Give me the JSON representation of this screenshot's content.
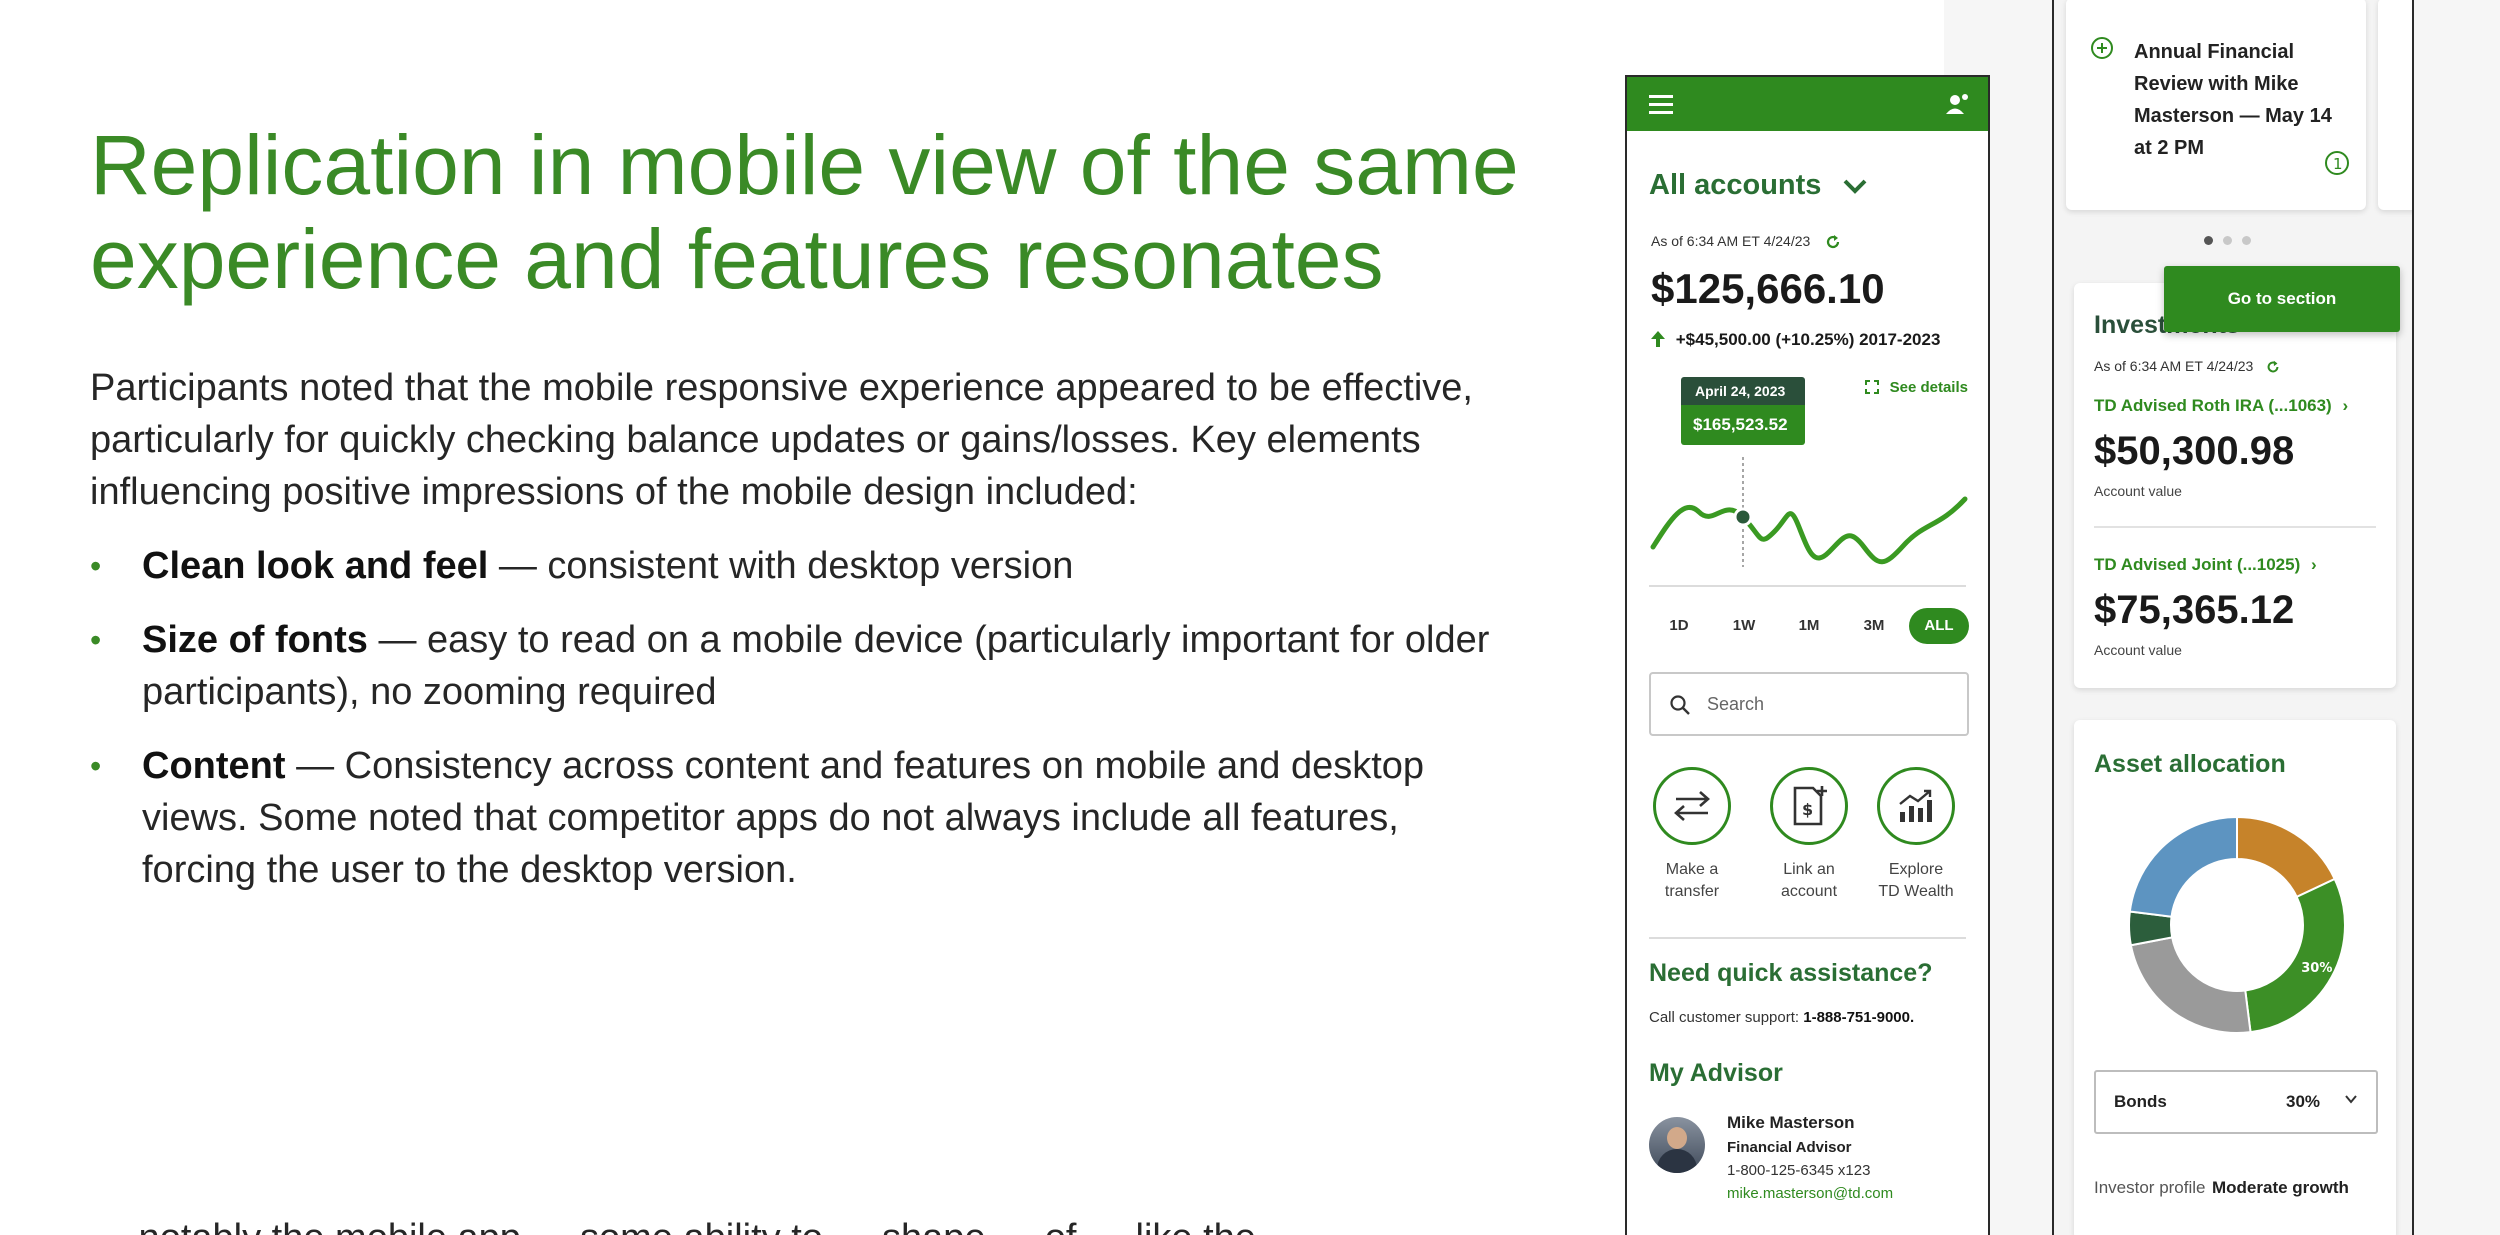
{
  "slide": {
    "title": "Replication in mobile view of the same experience and features resonates",
    "intro": "Participants noted that the mobile responsive experience appeared to be effective, particularly for quickly checking balance updates or gains/losses. Key elements influencing positive impressions of the mobile design included:",
    "bullets": [
      {
        "bold": "Clean look and feel",
        "text": " — consistent with desktop version"
      },
      {
        "bold": "Size of fonts",
        "text": " — easy to read on a mobile device (particularly important for older participants), no zooming required"
      },
      {
        "bold": "Content",
        "text": " — Consistency across content and features on mobile and desktop views. Some noted that competitor apps do not always include all features, forcing the user to the desktop version."
      }
    ],
    "cut_off_line": "… notably the mobile app … some ability to … shape … of … like the …"
  },
  "phone_main": {
    "header": {
      "menu_icon": "hamburger-icon",
      "user_icon": "user-settings-icon",
      "color": "#2f8a1f"
    },
    "accounts_heading": "All accounts",
    "as_of": "As of 6:34 AM ET 4/24/23",
    "balance": "$125,666.10",
    "gain": "+$45,500.00 (+10.25%) 2017-2023",
    "see_details": "See details",
    "tooltip": {
      "date": "April 24, 2023",
      "value": "$165,523.52"
    },
    "ranges": [
      "1D",
      "1W",
      "1M",
      "3M",
      "ALL"
    ],
    "active_range": "ALL",
    "search_placeholder": "Search",
    "actions": [
      {
        "l1": "Make a",
        "l2": "transfer",
        "icon": "transfer-icon"
      },
      {
        "l1": "Link an",
        "l2": "account",
        "icon": "link-account-icon"
      },
      {
        "l1": "Explore",
        "l2": "TD Wealth",
        "icon": "growth-chart-icon"
      }
    ],
    "assist_heading": "Need quick assistance?",
    "call_label": "Call customer support: ",
    "call_number": "1-888-751-9000.",
    "advisor_heading": "My Advisor",
    "advisor": {
      "name": "Mike Masterson",
      "title": "Financial Advisor",
      "phone": "1-800-125-6345 x123",
      "email": "mike.masterson@td.com"
    }
  },
  "phone_side": {
    "review_card": "Annual Financial Review with Mike Masterson — May 14 at 2 PM",
    "review_badge": "1",
    "go_to_section": "Go to section",
    "investments_heading": "Investments",
    "as_of": "As of 6:34 AM ET 4/24/23",
    "accounts": [
      {
        "name": "TD Advised Roth IRA (...1063)",
        "value": "$50,300.98",
        "sub": "Account value"
      },
      {
        "name": "TD Advised Joint  (...1025)",
        "value": "$75,365.12",
        "sub": "Account value"
      }
    ],
    "allocation_heading": "Asset allocation",
    "donut_label": "30%",
    "donut_segments": [
      {
        "name": "orange",
        "value": 0.18,
        "color": "#c6832a"
      },
      {
        "name": "green",
        "value": 0.3,
        "color": "#3c8f26"
      },
      {
        "name": "gray",
        "value": 0.24,
        "color": "#9a9a9a"
      },
      {
        "name": "darkgreen",
        "value": 0.05,
        "color": "#2c5e3c"
      },
      {
        "name": "blue",
        "value": 0.23,
        "color": "#5d94c1"
      }
    ],
    "select_label": "Bonds",
    "select_value": "30%",
    "profile_label": "Investor profile",
    "profile_value": "Moderate growth"
  }
}
